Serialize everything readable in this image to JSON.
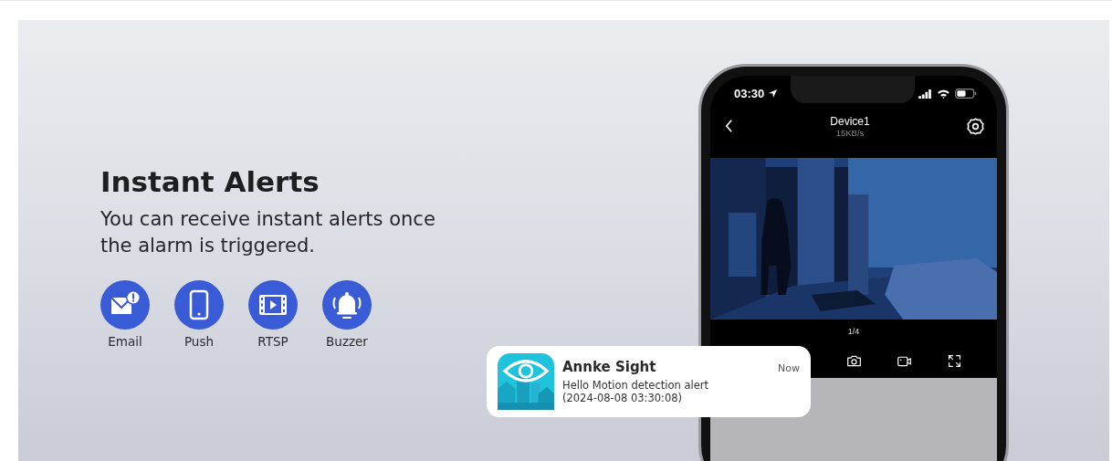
{
  "banner": {
    "title": "Instant Alerts",
    "subtitle": "You can receive instant alerts once the alarm is triggered.",
    "features": [
      {
        "kind": "email",
        "label": "Email"
      },
      {
        "kind": "push",
        "label": "Push"
      },
      {
        "kind": "rtsp",
        "label": "RTSP"
      },
      {
        "kind": "buzzer",
        "label": "Buzzer"
      }
    ]
  },
  "phone": {
    "status_bar": {
      "time": "03:30"
    },
    "nav": {
      "title": "Device1",
      "subtitle": "15KB/s"
    },
    "page_indicator": "1/4",
    "toolbar": [
      {
        "kind": "camera"
      },
      {
        "kind": "record"
      },
      {
        "kind": "fullscreen"
      }
    ]
  },
  "notification": {
    "app": "Annke Sight",
    "time": "Now",
    "message": "Hello Motion detection alert\n(2024-08-08 03:30:08)"
  }
}
